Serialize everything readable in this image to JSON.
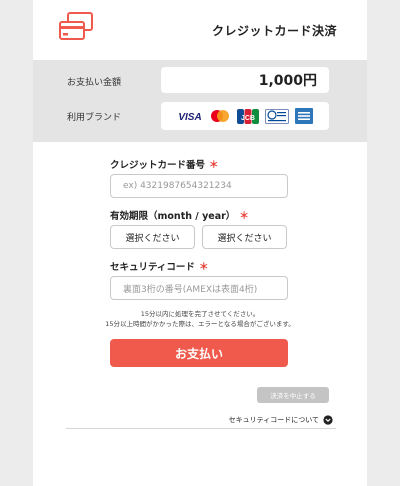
{
  "header": {
    "title": "クレジットカード決済",
    "icon": "credit-card-icon",
    "accent_color": "#ef5a4d"
  },
  "summary": {
    "amount_label": "お支払い金額",
    "amount_value": "1,000円",
    "brand_label": "利用ブランド",
    "brands": [
      {
        "name": "VISA",
        "icon": "visa-icon"
      },
      {
        "name": "Mastercard",
        "icon": "mastercard-icon"
      },
      {
        "name": "JCB",
        "icon": "jcb-icon"
      },
      {
        "name": "Diners Club International",
        "icon": "diners-icon"
      },
      {
        "name": "American Express",
        "icon": "amex-icon"
      }
    ]
  },
  "form": {
    "card_number_label": "クレジットカード番号",
    "card_number_placeholder": "ex) 4321987654321234",
    "expiry_label": "有効期限（month / year）",
    "expiry_month_select": "選択ください",
    "expiry_year_select": "選択ください",
    "security_code_label": "セキュリティコード",
    "security_code_placeholder": "裏面3桁の番号(AMEXは表面4桁)",
    "required_mark": "＊",
    "note_line1": "15分以内に処理を完了させてください。",
    "note_line2": "15分以上時間がかかった際は、エラーとなる場合がございます。"
  },
  "actions": {
    "pay_label": "お支払い",
    "cancel_label": "決済を中止する",
    "security_code_info_label": "セキュリティコードについて"
  }
}
